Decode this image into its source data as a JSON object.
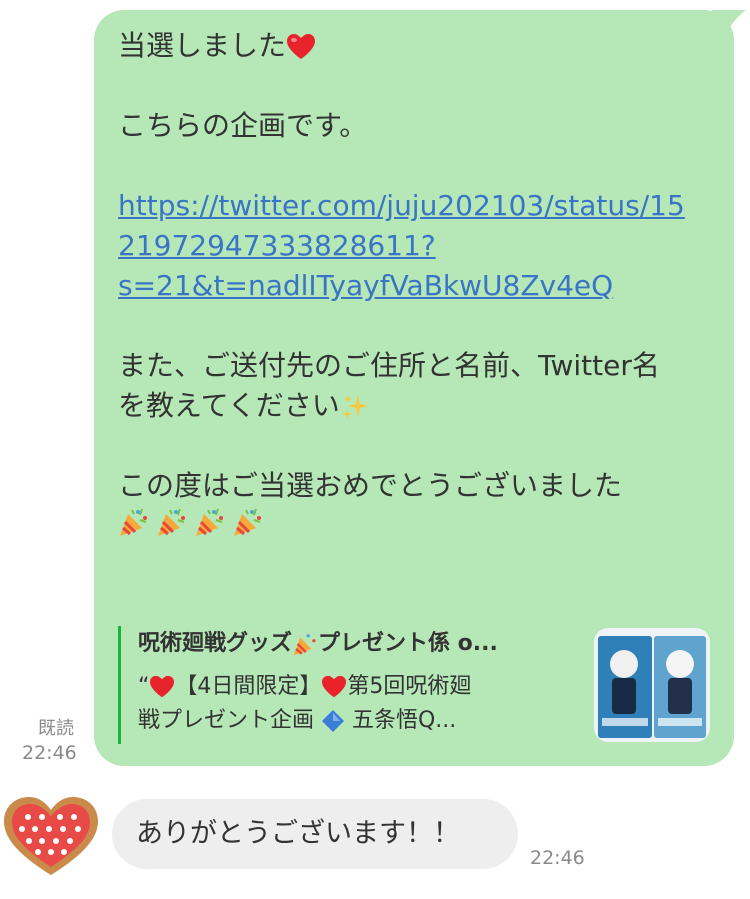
{
  "outgoing": {
    "line1": "当選しました",
    "line1_emoji": "red-heart",
    "line2": "こちらの企画です。",
    "link_line1": "https://twitter.com/juju202103/status/15",
    "link_line2": "21972947333828611?",
    "link_line3": "s=21&t=nadlITyayfVaBkwU8Zv4eQ",
    "line3a": "また、ご送付先のご住所と名前、Twitter名",
    "line3b": "を教えてください",
    "line3b_emoji": "sparkles",
    "line4": "この度はご当選おめでとうございました",
    "line5_emoji": "party-popper x4",
    "preview": {
      "title_a": "呪術廻戦グッズ",
      "title_b": "プレゼント係 o...",
      "desc1_a": "“",
      "desc1_b": "【4日間限定】",
      "desc1_c": "第5回呪術廻",
      "desc2_a": "戦プレゼント企画 ",
      "desc2_b": " 五条悟Q..."
    },
    "read_status": "既読",
    "time": "22:46",
    "bubble_color": "#b6e7b6",
    "link_color": "#3a74c6",
    "preview_bar_color": "#17b539"
  },
  "incoming": {
    "text": "ありがとうございます！！",
    "time": "22:46",
    "bubble_color": "#eeeeee",
    "avatar": "heart-cookie-avatar"
  }
}
